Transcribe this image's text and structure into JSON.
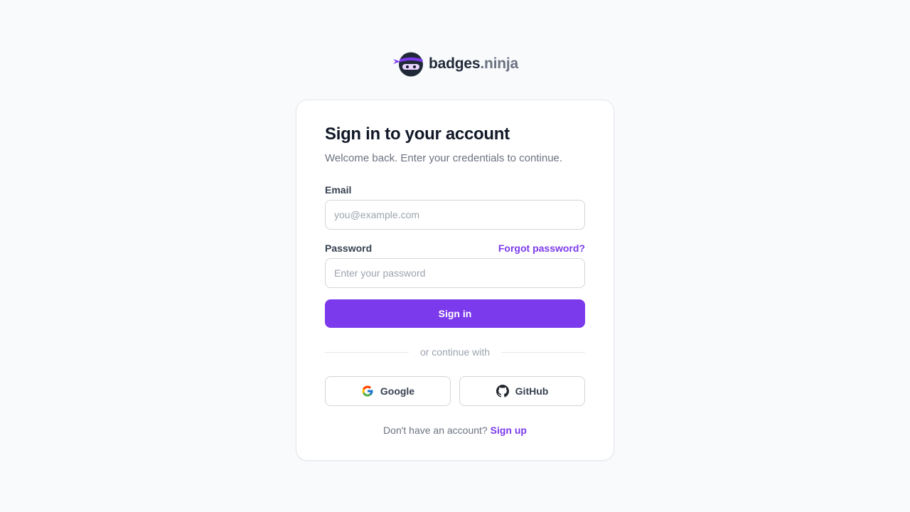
{
  "brand": {
    "name": "badges",
    "tld": ".ninja",
    "logo_icon": "ninja-mascot-icon",
    "colors": {
      "headband": "#7c3aed",
      "face": "#1f2937"
    }
  },
  "card": {
    "title": "Sign in to your account",
    "subtitle": "Welcome back. Enter your credentials to continue."
  },
  "form": {
    "email": {
      "label": "Email",
      "placeholder": "you@example.com",
      "value": ""
    },
    "password": {
      "label": "Password",
      "placeholder": "Enter your password",
      "value": "",
      "forgot_label": "Forgot password?"
    },
    "submit_label": "Sign in"
  },
  "divider": {
    "text": "or continue with"
  },
  "social": {
    "google": {
      "label": "Google",
      "icon": "google-icon"
    },
    "github": {
      "label": "GitHub",
      "icon": "github-icon"
    }
  },
  "footer": {
    "prompt": "Don't have an account?",
    "signup_label": "Sign up"
  },
  "colors": {
    "accent": "#7c3aed",
    "background": "#f8fafc",
    "card": "#ffffff",
    "border": "#e5e7eb"
  }
}
